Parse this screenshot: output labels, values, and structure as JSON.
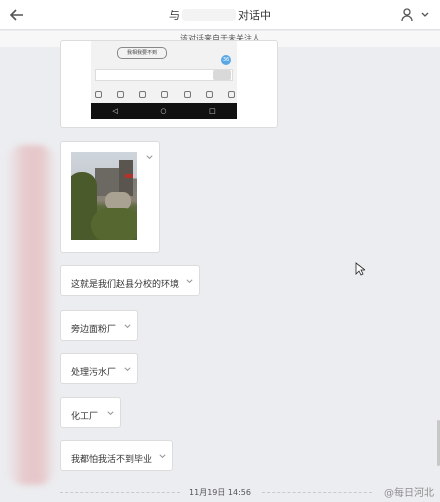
{
  "header": {
    "title_prefix": "与",
    "title_suffix": "对话中"
  },
  "notice": "该对话来自于未关注人",
  "screenshot_preview": {
    "doodle_text": "我相我要不到",
    "badge": "36"
  },
  "messages": [
    {
      "text": "这就是我们赵县分校的环境"
    },
    {
      "text": "旁边面粉厂"
    },
    {
      "text": "处理污水厂"
    },
    {
      "text": "化工厂"
    },
    {
      "text": "我都怕我活不到毕业"
    }
  ],
  "timestamp": "11月19日 14:56",
  "watermark": "@每日河北",
  "icons": {
    "back": "arrow-left-icon",
    "user": "user-icon",
    "dropdown": "chevron-down-icon",
    "cursor": "mouse-cursor-icon"
  },
  "colors": {
    "background": "#ecedf0",
    "bubble": "#ffffff",
    "badge": "#5aa7e6"
  }
}
